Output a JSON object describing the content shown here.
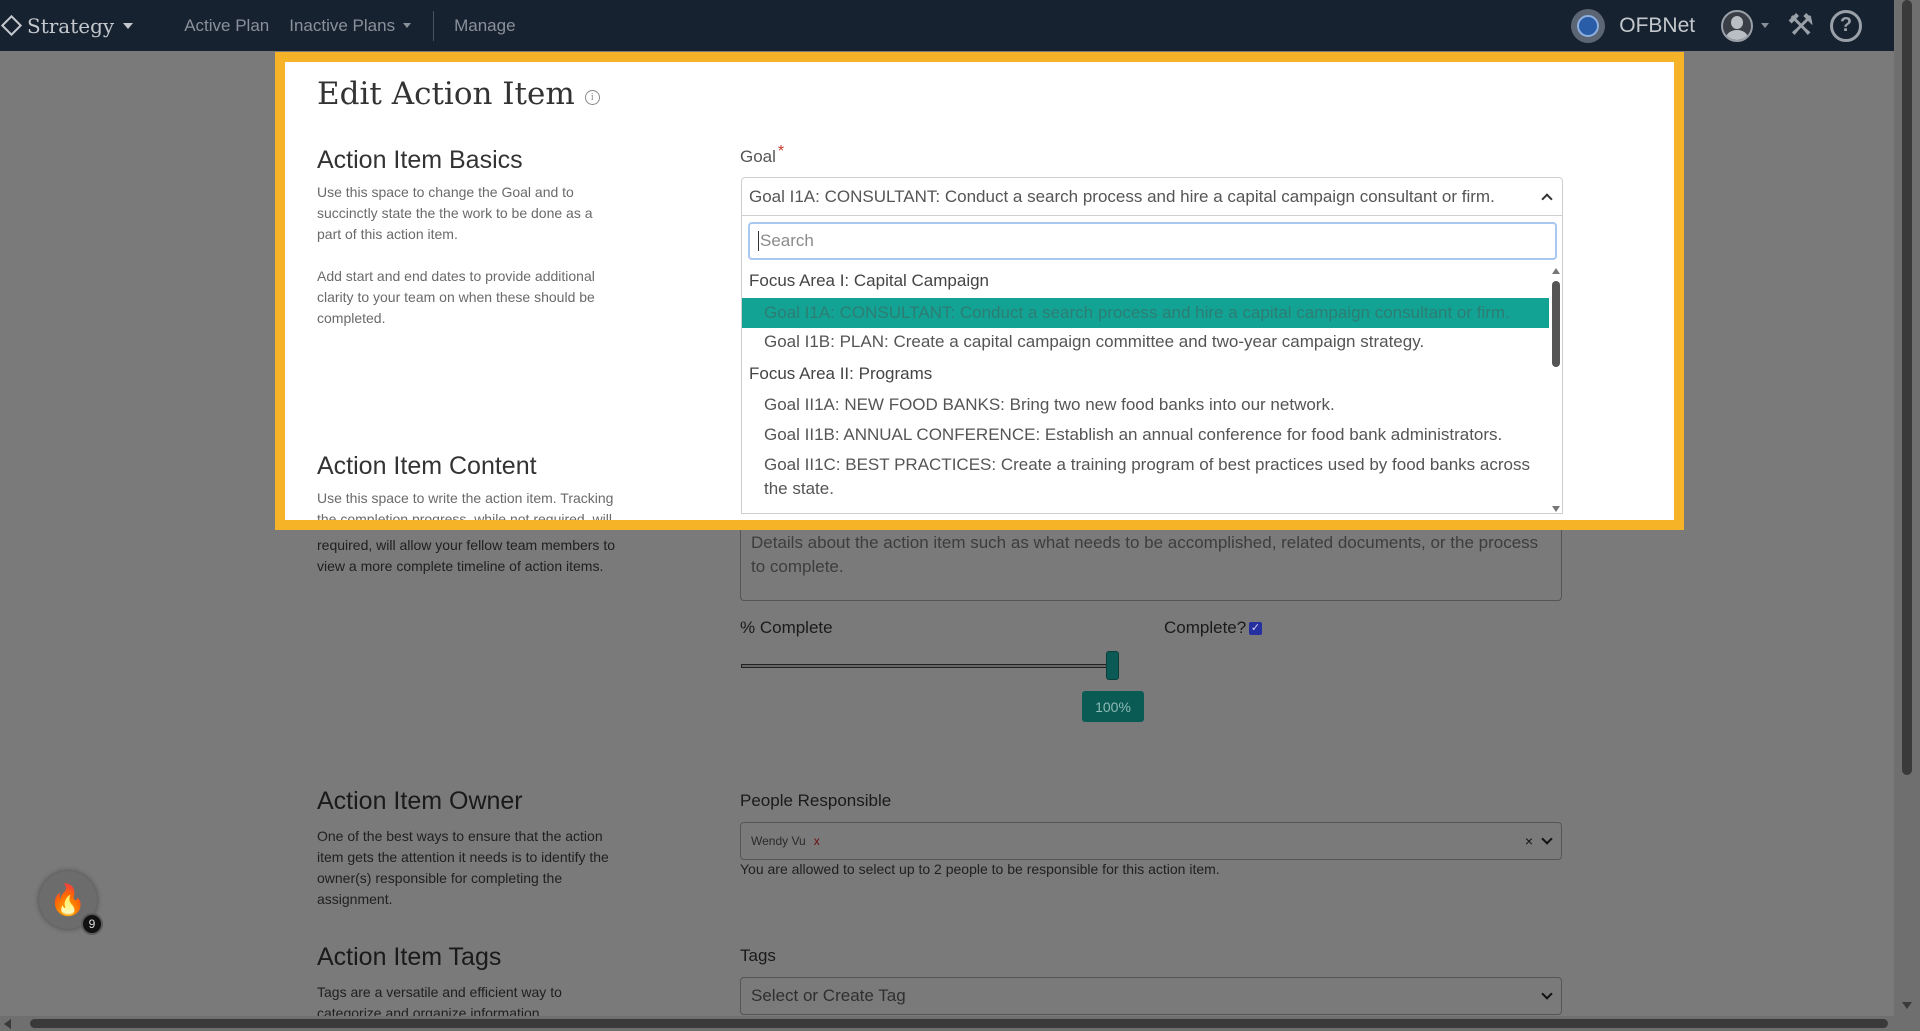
{
  "navbar": {
    "brand": "Strategy",
    "links": [
      "Active Plan",
      "Inactive Plans",
      "Manage"
    ],
    "org_name": "OFBNet",
    "icons": [
      "org-logo-icon",
      "user-avatar-icon",
      "tools-icon",
      "help-icon"
    ]
  },
  "modal": {
    "title": "Edit Action Item",
    "basics": {
      "title": "Action Item Basics",
      "desc1": "Use this space to change the Goal and to succinctly state the the work to be done as a part of this action item.",
      "desc2": "Add start and end dates to provide additional clarity to your team on when these should be completed."
    },
    "content": {
      "title": "Action Item Content",
      "desc": "Use this space to write the action item. Tracking the completion progress, while not required, will allow your fellow team members to view a more complete timeline of action items."
    },
    "goal": {
      "label": "Goal",
      "required_mark": "*",
      "selected": "Goal I1A: CONSULTANT: Conduct a search process and hire a capital campaign consultant or firm.",
      "search_placeholder": "Search",
      "groups": [
        {
          "label": "Focus Area I: Capital Campaign",
          "options": [
            "Goal I1A: CONSULTANT: Conduct a search process and hire a capital campaign consultant or firm.",
            "Goal I1B: PLAN: Create a capital campaign committee and two-year campaign strategy."
          ]
        },
        {
          "label": "Focus Area II: Programs",
          "options": [
            "Goal II1A: NEW FOOD BANKS: Bring two new food banks into our network.",
            "Goal II1B: ANNUAL CONFERENCE: Establish an annual conference for food bank administrators.",
            "Goal II1C: BEST PRACTICES: Create a training program of best practices used by food banks across the state."
          ]
        }
      ]
    }
  },
  "page": {
    "content_desc_tail": "required, will allow your fellow team members to view a more complete timeline of action items.",
    "details_placeholder": "Details about the action item such as what needs to be accomplished, related documents, or the process to complete.",
    "percent_label": "% Complete",
    "percent_value": "100%",
    "percent": 100,
    "complete_label": "Complete?",
    "complete_checked": true,
    "owner": {
      "title": "Action Item Owner",
      "desc": "One of the best ways to ensure that the action item gets the attention it needs is to identify the owner(s) responsible for completing the assignment.",
      "people_label": "People Responsible",
      "chip": "Wendy Vu",
      "chip_remove": "x",
      "clear": "×",
      "help": "You are allowed to select up to 2 people to be responsible for this action item."
    },
    "tags": {
      "title": "Action Item Tags",
      "desc": "Tags are a versatile and efficient way to categorize and organize information.",
      "label": "Tags",
      "placeholder": "Select or Create Tag"
    },
    "badge_count": "9"
  },
  "colors": {
    "navbar": "#172231",
    "highlight_border": "#f6b328",
    "active_option": "#12a394",
    "slider": "#0b5b55"
  }
}
